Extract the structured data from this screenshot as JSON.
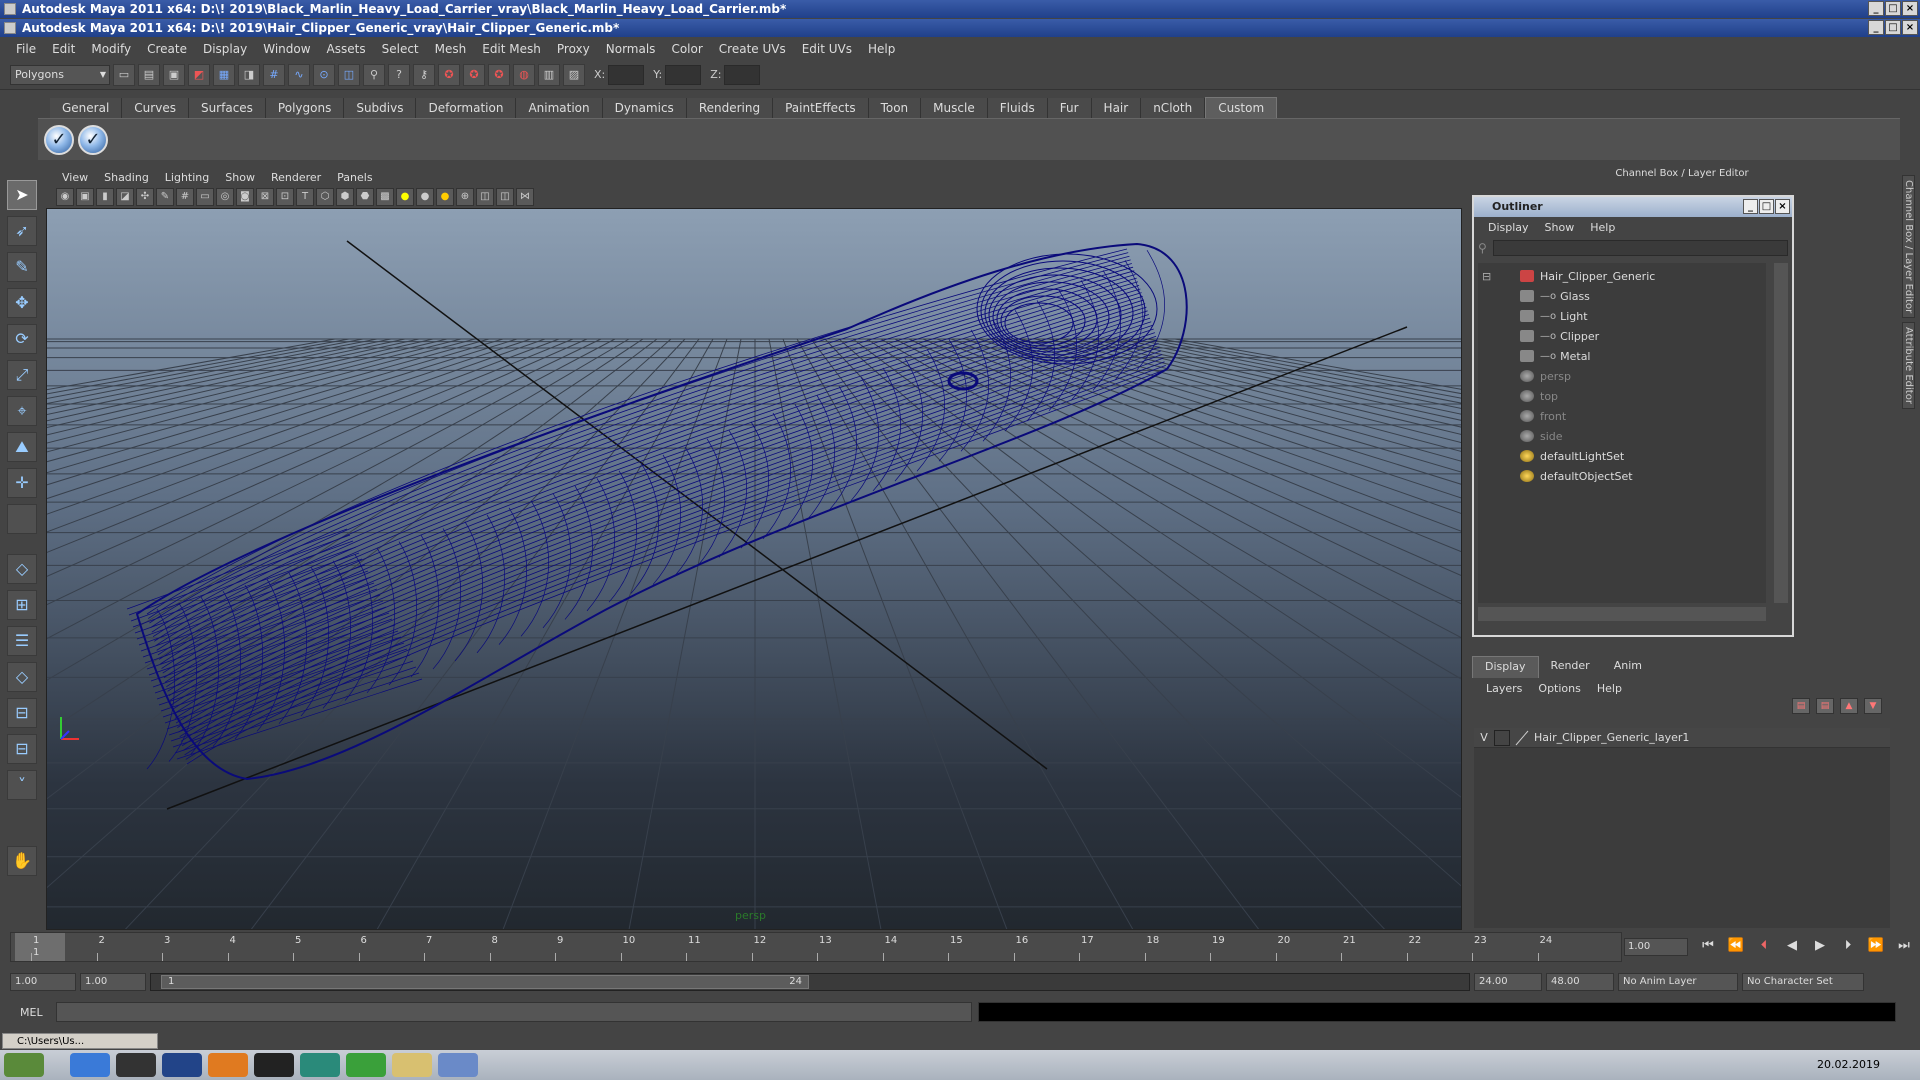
{
  "window": {
    "title1": "Autodesk Maya 2011 x64: D:\\! 2019\\Black_Marlin_Heavy_Load_Carrier_vray\\Black_Marlin_Heavy_Load_Carrier.mb*",
    "title2": "Autodesk Maya 2011 x64: D:\\! 2019\\Hair_Clipper_Generic_vray\\Hair_Clipper_Generic.mb*"
  },
  "menubar": [
    "File",
    "Edit",
    "Modify",
    "Create",
    "Display",
    "Window",
    "Assets",
    "Select",
    "Mesh",
    "Edit Mesh",
    "Proxy",
    "Normals",
    "Color",
    "Create UVs",
    "Edit UVs",
    "Help"
  ],
  "statusline": {
    "mode": "Polygons",
    "x_label": "X:",
    "y_label": "Y:",
    "z_label": "Z:"
  },
  "shelf": {
    "tabs": [
      "General",
      "Curves",
      "Surfaces",
      "Polygons",
      "Subdivs",
      "Deformation",
      "Animation",
      "Dynamics",
      "Rendering",
      "PaintEffects",
      "Toon",
      "Muscle",
      "Fluids",
      "Fur",
      "Hair",
      "nCloth",
      "Custom"
    ],
    "active_tab": "Custom"
  },
  "panel_menu": [
    "View",
    "Shading",
    "Lighting",
    "Show",
    "Renderer",
    "Panels"
  ],
  "viewport": {
    "camera": "persp",
    "wire_color": "#0a0a7a"
  },
  "channel_box": {
    "header": "Channel Box / Layer Editor",
    "side_tabs": [
      "Channel Box / Layer Editor",
      "Attribute Editor"
    ]
  },
  "outliner": {
    "title": "Outliner",
    "menu": [
      "Display",
      "Show",
      "Help"
    ],
    "items": [
      {
        "label": "Hair_Clipper_Generic",
        "type": "group",
        "depth": 0
      },
      {
        "label": "Glass",
        "type": "mesh",
        "depth": 1
      },
      {
        "label": "Light",
        "type": "mesh",
        "depth": 1
      },
      {
        "label": "Clipper",
        "type": "mesh",
        "depth": 1
      },
      {
        "label": "Metal",
        "type": "mesh",
        "depth": 1
      },
      {
        "label": "persp",
        "type": "camera",
        "depth": 0
      },
      {
        "label": "top",
        "type": "camera",
        "depth": 0
      },
      {
        "label": "front",
        "type": "camera",
        "depth": 0
      },
      {
        "label": "side",
        "type": "camera",
        "depth": 0
      },
      {
        "label": "defaultLightSet",
        "type": "set",
        "depth": 0
      },
      {
        "label": "defaultObjectSet",
        "type": "set",
        "depth": 0
      }
    ]
  },
  "layer_editor": {
    "tabs": [
      "Display",
      "Render",
      "Anim"
    ],
    "active_tab": "Display",
    "menu": [
      "Layers",
      "Options",
      "Help"
    ],
    "layers": [
      {
        "visible": "V",
        "name": "Hair_Clipper_Generic_layer1"
      }
    ]
  },
  "timeline": {
    "ticks": [
      "1",
      "2",
      "3",
      "4",
      "5",
      "6",
      "7",
      "8",
      "9",
      "10",
      "11",
      "12",
      "13",
      "14",
      "15",
      "16",
      "17",
      "18",
      "19",
      "20",
      "21",
      "22",
      "23",
      "24"
    ],
    "current_frame_label": "1",
    "current_time": "1.00"
  },
  "range": {
    "start": "1.00",
    "playback_start": "1.00",
    "slider_start": "1",
    "slider_end": "24",
    "playback_end": "24.00",
    "end": "48.00",
    "anim_layer": "No Anim Layer",
    "character_set": "No Character Set"
  },
  "cmdline": {
    "label": "MEL"
  },
  "taskbar": {
    "window": "C:\\Users\\Us...",
    "date": "20.02.2019"
  }
}
